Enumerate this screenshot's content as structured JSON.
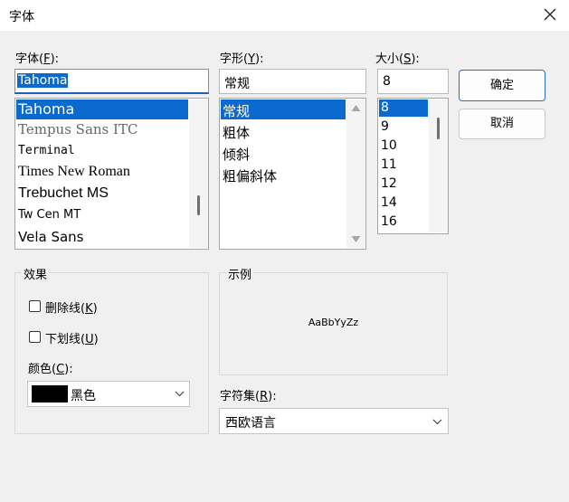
{
  "window": {
    "title": "字体"
  },
  "font": {
    "label_prefix": "字体(",
    "label_key": "F",
    "label_suffix": "):",
    "value": "Tahoma",
    "items": [
      "Tahoma",
      "Tempus Sans ITC",
      "Terminal",
      "Times New Roman",
      "Trebuchet MS",
      "Tw Cen MT",
      "Vela Sans"
    ],
    "selected_index": 0
  },
  "style": {
    "label_prefix": "字形(",
    "label_key": "Y",
    "label_suffix": "):",
    "value": "常规",
    "items": [
      "常规",
      "粗体",
      "倾斜",
      "粗偏斜体"
    ],
    "selected_index": 0
  },
  "size": {
    "label_prefix": "大小(",
    "label_key": "S",
    "label_suffix": "):",
    "value": "8",
    "items": [
      "8",
      "9",
      "10",
      "11",
      "12",
      "14",
      "16"
    ],
    "selected_index": 0
  },
  "buttons": {
    "ok": "确定",
    "cancel": "取消"
  },
  "effects": {
    "title": "效果",
    "strikeout_prefix": "删除线(",
    "strikeout_key": "K",
    "strikeout_suffix": ")",
    "strikeout_checked": false,
    "underline_prefix": "下划线(",
    "underline_key": "U",
    "underline_suffix": ")",
    "underline_checked": false,
    "color_label_prefix": "颜色(",
    "color_label_key": "C",
    "color_label_suffix": "):",
    "color_value": "黑色",
    "color_swatch": "#000000"
  },
  "sample": {
    "title": "示例",
    "text": "AaBbYyZz"
  },
  "charset": {
    "label_prefix": "字符集(",
    "label_key": "R",
    "label_suffix": "):",
    "value": "西欧语言"
  },
  "icons": {
    "close": "close-icon",
    "scroll_up": "scroll-up-arrow-icon",
    "scroll_down": "scroll-down-arrow-icon",
    "dropdown": "chevron-down-icon"
  },
  "colors": {
    "selection": "#0a6ad0",
    "accent": "#1f5fbf"
  }
}
